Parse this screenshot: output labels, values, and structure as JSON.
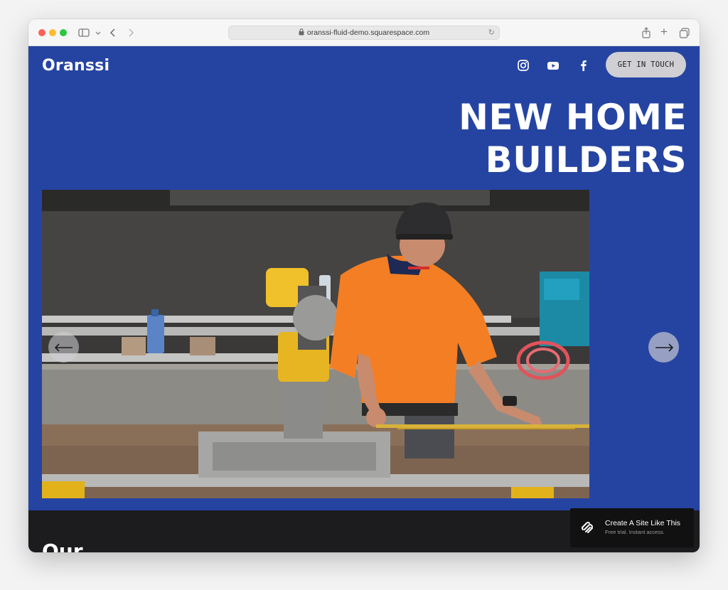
{
  "browser": {
    "url": "oranssi-fluid-demo.squarespace.com"
  },
  "site": {
    "logo": "Oranssi",
    "social_icons": [
      "instagram-icon",
      "youtube-icon",
      "facebook-icon"
    ],
    "cta_label": "GET IN TOUCH"
  },
  "hero": {
    "title_line1": "NEW HOME",
    "title_line2": "BUILDERS",
    "image_alt": "Construction worker in orange shirt using a miter saw"
  },
  "next_section": {
    "title": "Our"
  },
  "squarespace_badge": {
    "title": "Create A Site Like This",
    "subtitle": "Free trial. Instant access."
  },
  "colors": {
    "brand_blue": "#2544a2",
    "dark_section": "#1c1c1e",
    "cta_bg": "#cfcfd4"
  }
}
